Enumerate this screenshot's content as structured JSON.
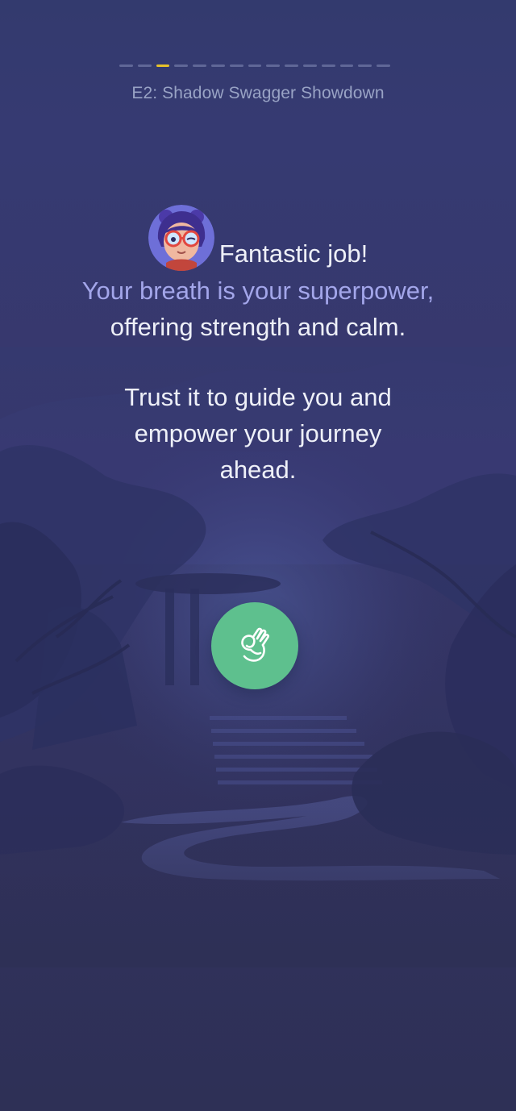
{
  "progress": {
    "total_segments": 15,
    "active_index": 2
  },
  "episode": {
    "title": "E2: Shadow Swagger Showdown"
  },
  "message": {
    "headline": "Fantastic job!",
    "highlight": "Your breath is your superpower,",
    "line1": "offering strength and calm.",
    "line2": "Trust it to guide you and",
    "line3": "empower your journey",
    "line4": "ahead."
  },
  "icons": {
    "avatar": "character-avatar",
    "action": "ok-hand-icon"
  },
  "colors": {
    "accent_green": "#5ec08e",
    "highlight_text": "#a3a6ea",
    "progress_active": "#e7c22a"
  }
}
